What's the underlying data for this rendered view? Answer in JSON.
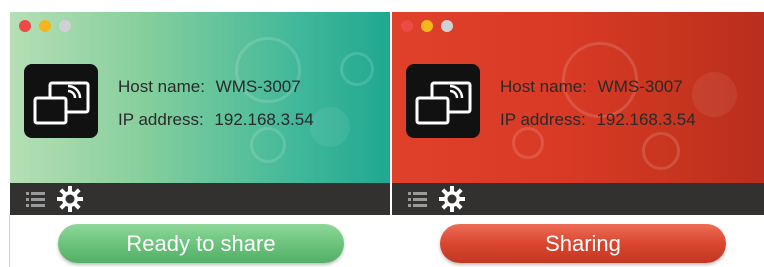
{
  "panels": [
    {
      "state": "ready",
      "host_label": "Host name:",
      "host_value": "WMS-3007",
      "ip_label": "IP address:",
      "ip_value": "192.168.3.54",
      "status_label": "Ready to share",
      "theme_color": "#4fb79a",
      "status_color": "#6cc47d"
    },
    {
      "state": "sharing",
      "host_label": "Host name:",
      "host_value": "WMS-3007",
      "ip_label": "IP address:",
      "ip_value": "192.168.3.54",
      "status_label": "Sharing",
      "theme_color": "#d93a26",
      "status_color": "#db4630"
    }
  ],
  "icons": {
    "app": "screen-mirror-icon",
    "list": "list-icon",
    "settings": "gear-icon",
    "window_controls": [
      "close-dot",
      "minimize-dot",
      "maximize-dot"
    ]
  }
}
